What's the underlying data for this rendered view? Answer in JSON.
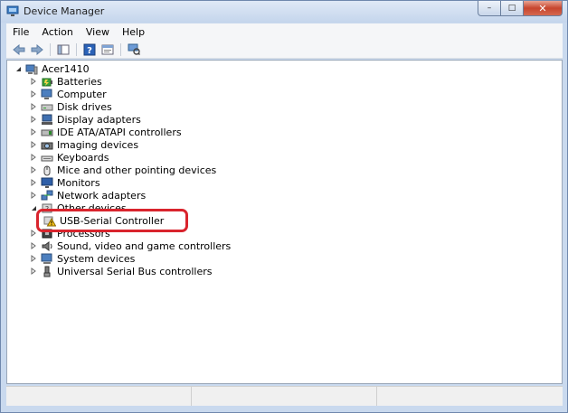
{
  "window": {
    "title": "Device Manager"
  },
  "window_controls": {
    "minimize": "–",
    "maximize": "□",
    "close": "✕"
  },
  "menu": [
    "File",
    "Action",
    "View",
    "Help"
  ],
  "tree": {
    "root": "Acer1410",
    "items": [
      {
        "label": "Batteries",
        "icon": "battery-icon"
      },
      {
        "label": "Computer",
        "icon": "computer-icon"
      },
      {
        "label": "Disk drives",
        "icon": "disk-drive-icon"
      },
      {
        "label": "Display adapters",
        "icon": "display-adapter-icon"
      },
      {
        "label": "IDE ATA/ATAPI controllers",
        "icon": "ide-controller-icon"
      },
      {
        "label": "Imaging devices",
        "icon": "camera-icon"
      },
      {
        "label": "Keyboards",
        "icon": "keyboard-icon"
      },
      {
        "label": "Mice and other pointing devices",
        "icon": "mouse-icon"
      },
      {
        "label": "Monitors",
        "icon": "monitor-icon"
      },
      {
        "label": "Network adapters",
        "icon": "network-adapter-icon"
      },
      {
        "label": "Other devices",
        "icon": "other-devices-icon",
        "expanded": true,
        "children": [
          {
            "label": "USB-Serial Controller",
            "icon": "warning-device-icon"
          }
        ]
      },
      {
        "label": "Processors",
        "icon": "processor-icon"
      },
      {
        "label": "Sound, video and game controllers",
        "icon": "speaker-icon"
      },
      {
        "label": "System devices",
        "icon": "system-devices-icon"
      },
      {
        "label": "Universal Serial Bus controllers",
        "icon": "usb-icon"
      }
    ]
  },
  "colors": {
    "highlight": "#d9242d",
    "title_bar": "#c9d9ee"
  }
}
